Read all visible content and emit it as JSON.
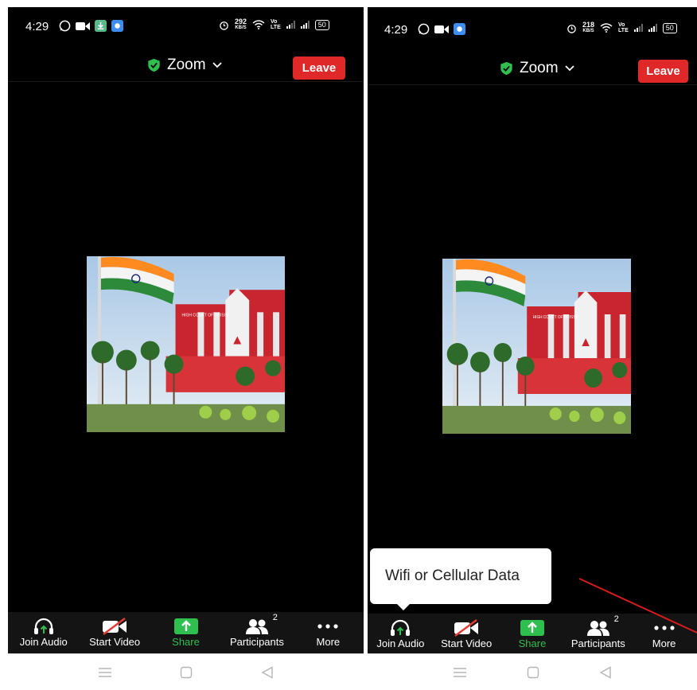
{
  "panels": [
    {
      "status": {
        "time": "4:29",
        "speed_value": "292",
        "speed_unit": "KB/S",
        "volte": "Vo\nLTE",
        "battery": "50"
      },
      "meeting": {
        "title": "Zoom",
        "leave_label": "Leave"
      },
      "toolbar": {
        "join_audio": "Join Audio",
        "start_video": "Start Video",
        "share": "Share",
        "participants": "Participants",
        "participants_count": "2",
        "more": "More"
      }
    },
    {
      "status": {
        "time": "4:29",
        "speed_value": "218",
        "speed_unit": "KB/S",
        "volte": "Vo\nLTE",
        "battery": "50"
      },
      "meeting": {
        "title": "Zoom",
        "leave_label": "Leave"
      },
      "toolbar": {
        "join_audio": "Join Audio",
        "start_video": "Start Video",
        "share": "Share",
        "participants": "Participants",
        "participants_count": "2",
        "more": "More"
      },
      "tooltip": "Wifi or Cellular Data"
    }
  ],
  "image_sign": "HIGH COURT OF ORISSA",
  "colors": {
    "leave": "#e02828",
    "share": "#2fbf4f",
    "shield": "#2fbf4f",
    "annotation_arrow": "#d81b1b"
  },
  "icons": [
    "whatsapp-icon",
    "video-icon",
    "download-icon",
    "app-icon",
    "alarm-icon",
    "wifi-icon",
    "signal-icon",
    "battery-icon",
    "shield-check-icon",
    "chevron-down-icon",
    "headphones-icon",
    "video-off-icon",
    "share-arrow-icon",
    "participants-icon",
    "more-dots-icon",
    "menu-icon",
    "home-icon",
    "back-icon"
  ]
}
